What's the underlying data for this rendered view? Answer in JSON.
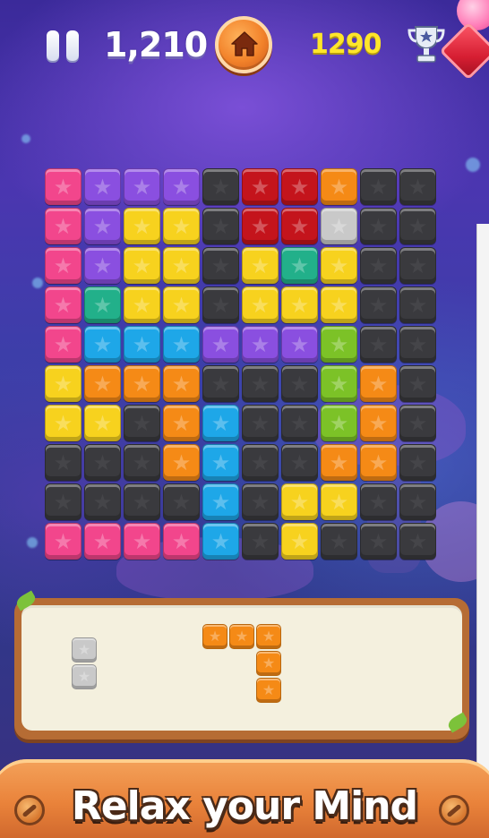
{
  "hud": {
    "score": "1,210",
    "best_score": "1290",
    "pause_icon": "pause-icon",
    "home_icon": "home-icon",
    "trophy_icon": "trophy-icon",
    "gem_icon": "gem-icon"
  },
  "colors": {
    "P": "#f2468c",
    "V": "#8a4fe0",
    "Y": "#f7d21e",
    "K": "#3a3a3e",
    "R": "#c4141c",
    "O": "#f58a16",
    "W": "#c9c9c9",
    "T": "#22b08a",
    "B": "#1ea7e8",
    "G": "#7cc227",
    "empty": "#3a3a3e"
  },
  "board": {
    "rows": [
      "PVVVKRROKK",
      "PVYYKRRWKK",
      "PVYYKYTYKK",
      "PTYYKYYYKK",
      "PBBBVVVGKK",
      "YOOOKKKGOK",
      "YYKOBKKGOK",
      "KKKOBKKOOK",
      "KKKKBKYYKK",
      "PPPPBKYKKK"
    ]
  },
  "tray": {
    "pieces": [
      {
        "name": "piece-vertical-two",
        "color": "W",
        "cells": [
          [
            0,
            0
          ],
          [
            0,
            1
          ]
        ]
      },
      {
        "name": "piece-seven",
        "color": "O",
        "cells": [
          [
            0,
            0
          ],
          [
            1,
            0
          ],
          [
            2,
            0
          ],
          [
            2,
            1
          ],
          [
            2,
            2
          ]
        ]
      }
    ]
  },
  "banner": {
    "text": "Relax your Mind"
  }
}
